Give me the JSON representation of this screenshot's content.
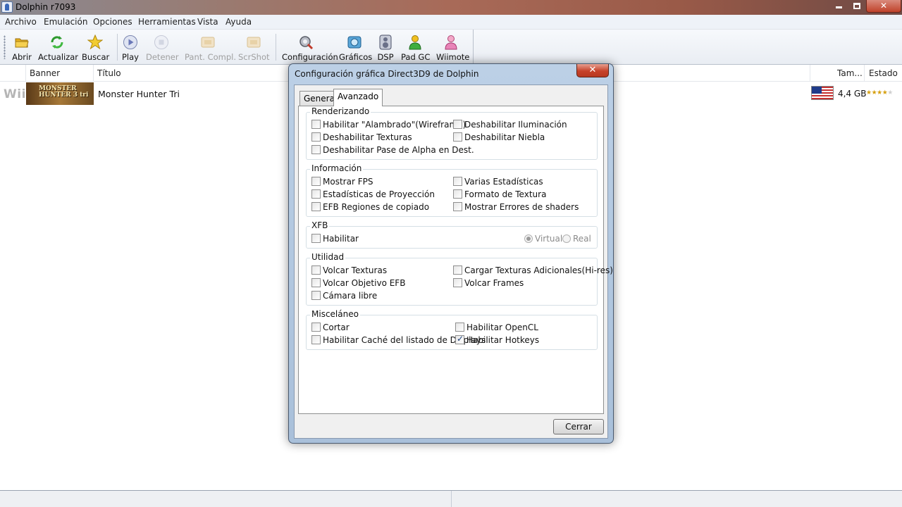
{
  "window": {
    "title": "Dolphin r7093"
  },
  "menu": [
    "Archivo",
    "Emulación",
    "Opciones",
    "Herramientas",
    "Vista",
    "Ayuda"
  ],
  "toolbar": {
    "buttons": [
      {
        "label": "Abrir",
        "icon": "folder-icon",
        "enabled": true
      },
      {
        "label": "Actualizar",
        "icon": "refresh-icon",
        "enabled": true
      },
      {
        "label": "Buscar",
        "icon": "star-search-icon",
        "enabled": true
      },
      {
        "label": "Play",
        "icon": "play-icon",
        "enabled": true
      },
      {
        "label": "Detener",
        "icon": "stop-icon",
        "enabled": false
      },
      {
        "label": "Pant. Compl.",
        "icon": "fullscreen-icon",
        "enabled": false
      },
      {
        "label": "ScrShot",
        "icon": "screenshot-icon",
        "enabled": false
      },
      {
        "label": "Configuración",
        "icon": "config-icon",
        "enabled": true
      },
      {
        "label": "Gráficos",
        "icon": "graphics-icon",
        "enabled": true
      },
      {
        "label": "DSP",
        "icon": "dsp-icon",
        "enabled": true
      },
      {
        "label": "Pad GC",
        "icon": "gc-pad-icon",
        "enabled": true
      },
      {
        "label": "Wiimote",
        "icon": "wiimote-icon",
        "enabled": true
      }
    ]
  },
  "list": {
    "columns": {
      "banner": "Banner",
      "title": "Título",
      "size": "Tam...",
      "state": "Estado"
    },
    "games": [
      {
        "platform": "Wii",
        "banner_text": "MONSTER HUNTER 3 tri",
        "title": "Monster Hunter Tri",
        "region": "USA",
        "size": "4,4 GB",
        "rating": 4
      }
    ]
  },
  "dialog": {
    "title": "Configuración gráfica Direct3D9 de Dolphin",
    "close_glyph": "✕",
    "tabs": [
      "General",
      "Avanzado"
    ],
    "active_tab": "Avanzado",
    "groups": {
      "render": {
        "label": "Renderizando",
        "wireframe": "Habilitar \"Alambrado\"(Wireframe)",
        "no_light": "Deshabilitar Iluminación",
        "no_tex": "Deshabilitar Texturas",
        "no_fog": "Deshabilitar Niebla",
        "no_alpha": "Deshabilitar Pase de Alpha en Dest."
      },
      "info": {
        "label": "Información",
        "fps": "Mostrar FPS",
        "stats": "Varias Estadísticas",
        "proj": "Estadísticas de Proyección",
        "texfmt": "Formato de Textura",
        "efb": "EFB Regiones de copiado",
        "shader_err": "Mostrar Errores de shaders"
      },
      "xfb": {
        "label": "XFB",
        "enable": "Habilitar",
        "virtual": "Virtual",
        "real": "Real"
      },
      "util": {
        "label": "Utilidad",
        "dump_tex": "Volcar Texturas",
        "hires": "Cargar Texturas Adicionales(Hi-res)",
        "dump_efb": "Volcar Objetivo EFB",
        "dump_frames": "Volcar Frames",
        "freecam": "Cámara libre"
      },
      "misc": {
        "label": "Misceláneo",
        "crop": "Cortar",
        "opencl": "Habilitar OpenCL",
        "dlcache": "Habilitar Caché del listado de Displays",
        "hotkeys": "Habilitar Hotkeys"
      }
    },
    "checked": [
      "hotkeys"
    ],
    "close_button": "Cerrar"
  },
  "colors": {
    "title_gradient_end": "#6e4a45",
    "dialog_frame": "#bcd0e6",
    "close_red": "#c6422a"
  }
}
